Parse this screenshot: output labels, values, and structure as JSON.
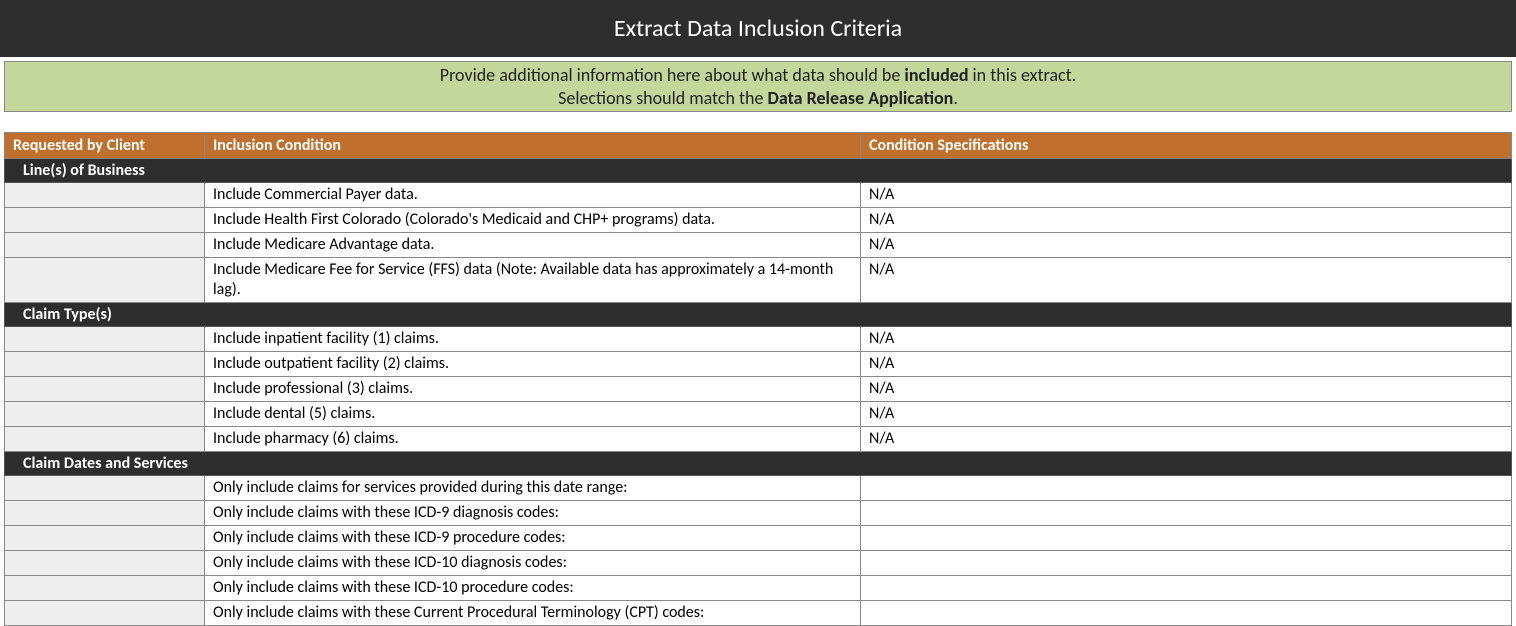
{
  "title": "Extract Data Inclusion Criteria",
  "instruction": {
    "line1_pre": "Provide additional information here about what data should be ",
    "line1_bold": "included",
    "line1_post": " in this extract.",
    "line2_pre": "Selections should match the ",
    "line2_bold": "Data Release Application",
    "line2_post": "."
  },
  "headers": {
    "col1": "Requested by Client",
    "col2": "Inclusion Condition",
    "col3": "Condition Specifications"
  },
  "sections": [
    {
      "label": "Line(s) of Business",
      "rows": [
        {
          "req": "",
          "cond": "Include Commercial Payer data.",
          "spec": "N/A"
        },
        {
          "req": "",
          "cond": "Include Health First Colorado (Colorado's Medicaid and CHP+ programs) data.",
          "spec": "N/A"
        },
        {
          "req": "",
          "cond": "Include Medicare Advantage data.",
          "spec": "N/A"
        },
        {
          "req": "",
          "cond": "Include Medicare Fee for Service (FFS) data (Note: Available data has approximately a 14-month lag).",
          "spec": "N/A"
        }
      ]
    },
    {
      "label": "Claim Type(s)",
      "rows": [
        {
          "req": "",
          "cond": "Include inpatient facility (1) claims.",
          "spec": "N/A"
        },
        {
          "req": "",
          "cond": "Include outpatient facility (2) claims.",
          "spec": "N/A"
        },
        {
          "req": "",
          "cond": "Include professional (3) claims.",
          "spec": "N/A"
        },
        {
          "req": "",
          "cond": "Include dental (5) claims.",
          "spec": "N/A"
        },
        {
          "req": "",
          "cond": "Include pharmacy (6) claims.",
          "spec": "N/A"
        }
      ]
    },
    {
      "label": "Claim Dates and Services",
      "rows": [
        {
          "req": "",
          "cond": "Only include claims for services provided during this date range:",
          "spec": ""
        },
        {
          "req": "",
          "cond": "Only include claims with these ICD-9 diagnosis codes:",
          "spec": ""
        },
        {
          "req": "",
          "cond": "Only include claims with these ICD-9 procedure codes:",
          "spec": ""
        },
        {
          "req": "",
          "cond": "Only include claims with these ICD-10 diagnosis codes:",
          "spec": ""
        },
        {
          "req": "",
          "cond": "Only include claims with these ICD-10 procedure codes:",
          "spec": ""
        },
        {
          "req": "",
          "cond": "Only include claims with these Current Procedural Terminology (CPT) codes:",
          "spec": ""
        }
      ]
    }
  ]
}
